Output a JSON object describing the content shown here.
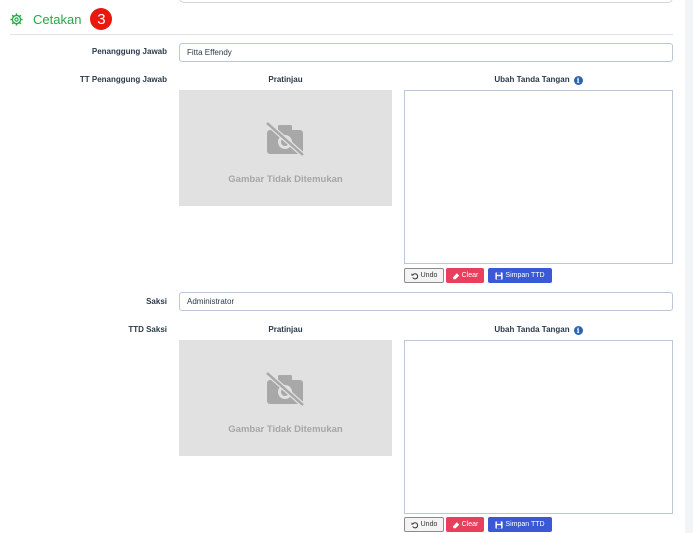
{
  "section": {
    "title": "Cetakan",
    "badge": "3"
  },
  "blocks": [
    {
      "label": "Penanggung Jawab",
      "value": "Fitta Effendy",
      "sig_label": "TT Penanggung Jawab",
      "preview_head": "Pratinjau",
      "preview_msg": "Gambar Tidak Ditemukan",
      "change_head": "Ubah Tanda Tangan",
      "buttons": {
        "undo": "Undo",
        "clear": "Clear",
        "save": "Simpan TTD"
      }
    },
    {
      "label": "Saksi",
      "value": "Administrator",
      "sig_label": "TTD Saksi",
      "preview_head": "Pratinjau",
      "preview_msg": "Gambar Tidak Ditemukan",
      "change_head": "Ubah Tanda Tangan",
      "buttons": {
        "undo": "Undo",
        "clear": "Clear",
        "save": "Simpan TTD"
      }
    }
  ],
  "icons": {
    "section": "gear-icon",
    "info": "info-icon",
    "preview": "camera-slash-icon",
    "undo": "undo-icon",
    "clear": "eraser-icon",
    "save": "floppy-icon"
  },
  "colors": {
    "accent": "#28a745",
    "badge": "#e8180c",
    "clear": "#e8405c",
    "save": "#3b58d6",
    "info": "#2f64ad"
  }
}
